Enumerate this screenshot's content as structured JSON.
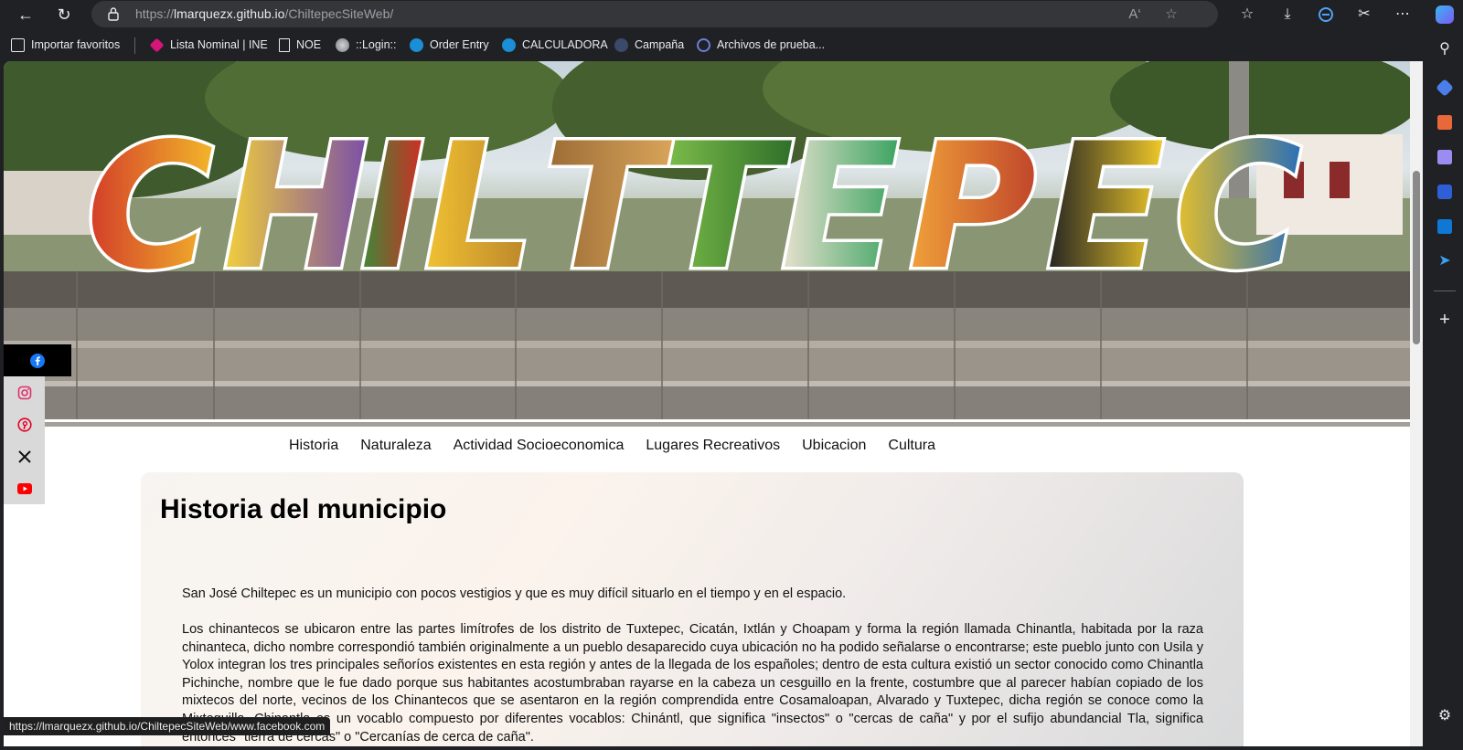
{
  "browser": {
    "url_prefix": "https://",
    "url_host": "lmarquezx.github.io",
    "url_path": "/ChiltepecSiteWeb/",
    "status_url": "https://lmarquezx.github.io/ChiltepecSiteWeb/www.facebook.com"
  },
  "bookmarks": [
    {
      "label": "Importar favoritos",
      "icon": "import-icon"
    },
    {
      "label": "Lista Nominal | INE",
      "icon": "ine-icon"
    },
    {
      "label": "NOE",
      "icon": "page-icon"
    },
    {
      "label": "::Login::",
      "icon": "globe-icon"
    },
    {
      "label": "Order Entry",
      "icon": "att-icon"
    },
    {
      "label": "CALCULADORA",
      "icon": "att-icon"
    },
    {
      "label": "Campaña",
      "icon": "campaign-icon"
    },
    {
      "label": "Archivos de prueba...",
      "icon": "files-icon"
    }
  ],
  "hero": {
    "letters": "CHILTEPEC",
    "caption": "Chiltepec"
  },
  "social": {
    "items": [
      "facebook-icon",
      "instagram-icon",
      "pinterest-icon",
      "x-icon",
      "youtube-icon"
    ]
  },
  "menu": [
    {
      "label": "Historia"
    },
    {
      "label": "Naturaleza"
    },
    {
      "label": "Actividad Socioeconomica"
    },
    {
      "label": "Lugares Recreativos"
    },
    {
      "label": "Ubicacion"
    },
    {
      "label": "Cultura"
    }
  ],
  "content": {
    "title": "Historia del municipio",
    "paragraph1": "San José Chiltepec es un municipio con pocos vestigios y que es muy difícil situarlo en el tiempo y en el espacio.",
    "paragraph2": "Los chinantecos se ubicaron entre las partes limítrofes de los distrito de Tuxtepec, Cicatán, Ixtlán y Choapam y forma la región llamada Chinantla, habitada por la raza chinanteca, dicho nombre correspondió también originalmente a un pueblo desaparecido cuya ubicación no ha podido señalarse o encontrarse; este pueblo junto con Usila y Yolox integran los tres principales señoríos existentes en esta región y antes de la llegada de los españoles; dentro de esta cultura existió un sector conocido como Chinantla Pichinche, nombre que le fue dado porque sus habitantes acostumbraban rayarse en la cabeza un cesguillo en la frente, costumbre que al parecer habían copiado de los mixtecos del norte, vecinos de los Chinantecos que se asentaron en la región comprendida entre Cosamaloapan, Alvarado y Tuxtepec, dicha región se conoce como la Mixtequilla. Chinantla es un vocablo compuesto por diferentes vocablos: Chinántl, que significa \"insectos\" o \"cercas de caña\" y por el sufijo abundancial Tla, significa entonces \"tierra de cercas\" o \"Cercanías de cerca de caña\"."
  },
  "colors": {
    "chrome_bg": "#202124",
    "address_bar": "#35363a",
    "social_active": "#000000",
    "social_bg": "#d9d9d9",
    "facebook": "#1877f2",
    "instagram": "#e1306c",
    "pinterest": "#e60023",
    "youtube": "#ff0000"
  }
}
